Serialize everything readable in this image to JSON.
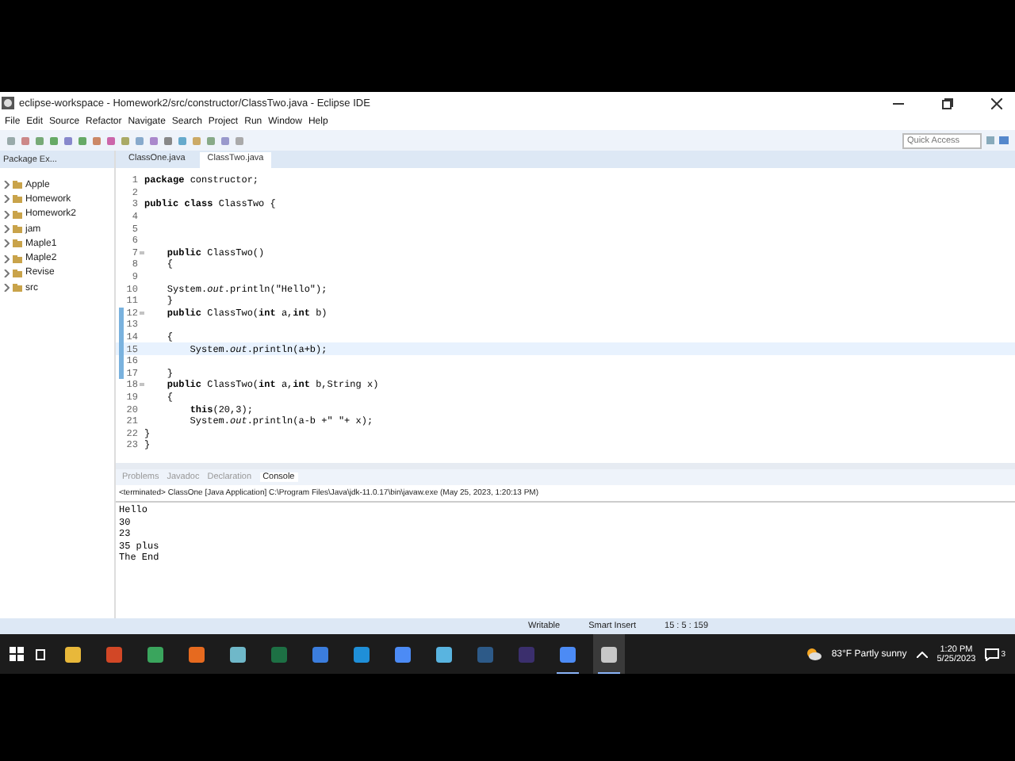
{
  "window": {
    "title": "eclipse-workspace - Homework2/src/constructor/ClassTwo.java - Eclipse IDE"
  },
  "menu": [
    "File",
    "Edit",
    "Source",
    "Refactor",
    "Navigate",
    "Search",
    "Project",
    "Run",
    "Window",
    "Help"
  ],
  "quick_access": {
    "placeholder": "Quick Access"
  },
  "package_explorer": {
    "title": "Package Ex...",
    "projects": [
      {
        "name": "Apple",
        "expanded": false
      },
      {
        "name": "Homework",
        "expanded": false
      },
      {
        "name": "Homework2",
        "expanded": false
      },
      {
        "name": "jam",
        "expanded": false
      },
      {
        "name": "Maple1",
        "expanded": false
      },
      {
        "name": "Maple2",
        "expanded": false
      },
      {
        "name": "Revise",
        "expanded": false
      },
      {
        "name": "src",
        "expanded": false
      }
    ]
  },
  "editor_tabs": [
    {
      "label": "ClassOne.java",
      "selected": false
    },
    {
      "label": "ClassTwo.java",
      "selected": true
    }
  ],
  "code_lines": [
    {
      "number": "1",
      "text": "**package** constructor;",
      "fold": false,
      "current": false,
      "marked": false
    },
    {
      "number": "2",
      "fold": false,
      "current": false,
      "marked": false
    },
    {
      "number": "3",
      "text": "**public** **class** ClassTwo {",
      "fold": false,
      "current": false,
      "marked": false
    },
    {
      "number": "4",
      "fold": false,
      "current": false,
      "marked": false
    },
    {
      "number": "5",
      "fold": false,
      "current": false,
      "marked": false
    },
    {
      "number": "6",
      "fold": false,
      "current": false,
      "marked": false
    },
    {
      "number": "7",
      "text": "    **public** ClassTwo()",
      "fold": true,
      "current": false,
      "marked": false
    },
    {
      "number": "8",
      "text": "    {",
      "fold": false,
      "current": false,
      "marked": false
    },
    {
      "number": "9",
      "fold": false,
      "current": false,
      "marked": false
    },
    {
      "number": "10",
      "text": "    System.*out*.println(\"Hello\");",
      "fold": false,
      "current": false,
      "marked": false
    },
    {
      "number": "11",
      "text": "    }",
      "fold": false,
      "current": false,
      "marked": false
    },
    {
      "number": "12",
      "text": "    **public** ClassTwo(**int** a,**int** b)",
      "fold": true,
      "current": false,
      "marked": true
    },
    {
      "number": "13",
      "fold": false,
      "current": false,
      "marked": true
    },
    {
      "number": "14",
      "text": "    {",
      "fold": false,
      "current": false,
      "marked": true
    },
    {
      "number": "15",
      "text": "        System.*out*.println(a+b);",
      "fold": false,
      "current": true,
      "marked": true
    },
    {
      "number": "16",
      "fold": false,
      "current": false,
      "marked": true
    },
    {
      "number": "17",
      "text": "    }",
      "fold": false,
      "current": false,
      "marked": true
    },
    {
      "number": "18",
      "text": "    **public** ClassTwo(**int** a,**int** b,String x)",
      "fold": true,
      "current": false,
      "marked": false
    },
    {
      "number": "19",
      "text": "    {",
      "fold": false,
      "current": false,
      "marked": false
    },
    {
      "number": "20",
      "text": "        **this**(20,3);",
      "fold": false,
      "current": false,
      "marked": false
    },
    {
      "number": "21",
      "text": "        System.*out*.println(a-b +\" \"+ x);",
      "fold": false,
      "current": false,
      "marked": false
    },
    {
      "number": "22",
      "text": "}",
      "fold": false,
      "current": false,
      "marked": false
    },
    {
      "number": "23",
      "text": "}",
      "fold": false,
      "current": false,
      "marked": false
    }
  ],
  "bottom_tabs": [
    {
      "label": "Problems",
      "selected": false
    },
    {
      "label": "Javadoc",
      "selected": false
    },
    {
      "label": "Declaration",
      "selected": false
    },
    {
      "label": "Console",
      "selected": true
    }
  ],
  "console": {
    "header": "<terminated> ClassOne [Java Application] C:\\Program Files\\Java\\jdk-11.0.17\\bin\\javaw.exe (May 25, 2023, 1:20:13 PM)",
    "output": [
      "Hello",
      "30",
      "23",
      "35 plus",
      "The End"
    ]
  },
  "status_bar": [
    "Writable",
    "Smart Insert",
    "15 : 5 : 159"
  ],
  "taskbar": {
    "apps": [
      {
        "kind": "folder",
        "running": false,
        "selected": false
      },
      {
        "kind": "red",
        "running": false,
        "selected": false
      },
      {
        "kind": "green",
        "running": false,
        "selected": false
      },
      {
        "kind": "orange",
        "running": false,
        "selected": false
      },
      {
        "kind": "teal",
        "running": false,
        "selected": false
      },
      {
        "kind": "darkgreen",
        "running": false,
        "selected": false
      },
      {
        "kind": "store",
        "running": false,
        "selected": false
      },
      {
        "kind": "blue",
        "running": false,
        "selected": false
      },
      {
        "kind": "chrome",
        "running": false,
        "selected": false
      },
      {
        "kind": "lightblue",
        "running": false,
        "selected": false
      },
      {
        "kind": "navy",
        "running": false,
        "selected": false
      },
      {
        "kind": "eclipse",
        "running": false,
        "selected": false
      },
      {
        "kind": "chrome",
        "running": true,
        "selected": false
      },
      {
        "kind": "gear",
        "running": true,
        "selected": true
      }
    ],
    "weather": "83°F  Partly sunny",
    "time": "1:20 PM",
    "date": "5/25/2023",
    "notifications": "3"
  }
}
